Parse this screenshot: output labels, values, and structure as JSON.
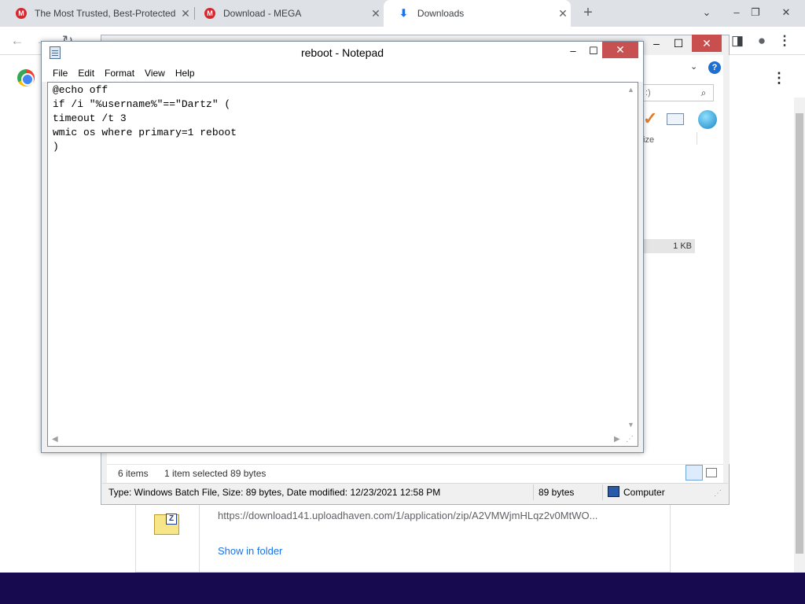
{
  "browser": {
    "tabs": [
      {
        "title": "The Most Trusted, Best-Protected",
        "favicon": "M"
      },
      {
        "title": "Download - MEGA",
        "favicon": "M"
      },
      {
        "title": "Downloads",
        "favicon": "download-icon"
      }
    ],
    "new_tab": "+",
    "window_controls": [
      "⌄",
      "–",
      "❐",
      "✕"
    ]
  },
  "downloads_page": {
    "item": {
      "url": "https://download141.uploadhaven.com/1/application/zip/A2VMWjmHLqz2v0MtWO...",
      "show_in_folder": "Show in folder"
    }
  },
  "explorer": {
    "search_placeholder": ":)",
    "column_header": "ize",
    "size_cell": "1 KB",
    "status": {
      "item_count": "6 items",
      "selection": "1 item selected  89 bytes",
      "details": "Type: Windows Batch File, Size: 89 bytes, Date modified: 12/23/2021 12:58 PM",
      "bytes": "89 bytes",
      "location": "Computer"
    }
  },
  "notepad": {
    "title": "reboot - Notepad",
    "menu": [
      "File",
      "Edit",
      "Format",
      "View",
      "Help"
    ],
    "content": "@echo off\nif /i \"%username%\"==\"Dartz\" (\ntimeout /t 3\nwmic os where primary=1 reboot\n)"
  },
  "colors": {
    "taskbar": "#180a4f",
    "close_button": "#c75050",
    "link": "#1a73e8"
  }
}
